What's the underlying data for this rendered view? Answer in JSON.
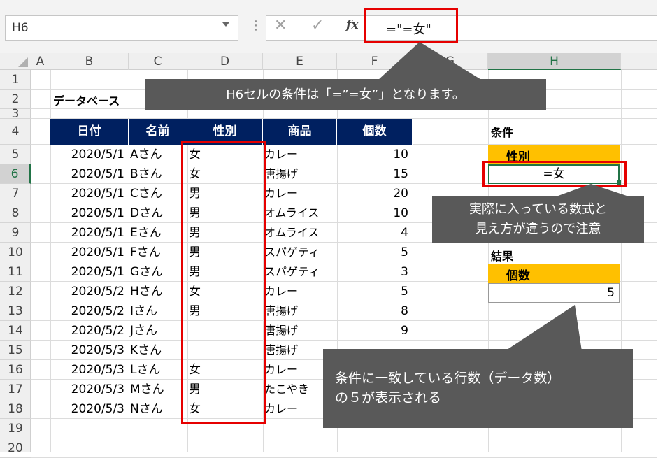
{
  "name_box": {
    "value": "H6"
  },
  "formula_bar": {
    "cancel_icon": "cross-icon",
    "enter_icon": "check-icon",
    "fx_label": "fx",
    "formula": "=\"=女\""
  },
  "columns": [
    "A",
    "B",
    "C",
    "D",
    "E",
    "F",
    "G",
    "H"
  ],
  "rows": [
    "1",
    "2",
    "3",
    "4",
    "5",
    "6",
    "7",
    "8",
    "9",
    "10",
    "11",
    "12",
    "13",
    "14",
    "15",
    "16",
    "17",
    "18",
    "19",
    "20"
  ],
  "database": {
    "title": "データベース",
    "headers": [
      "日付",
      "名前",
      "性別",
      "商品",
      "個数"
    ],
    "records": [
      [
        "2020/5/1",
        "Aさん",
        "女",
        "カレー",
        "10"
      ],
      [
        "2020/5/1",
        "Bさん",
        "女",
        "唐揚げ",
        "15"
      ],
      [
        "2020/5/1",
        "Cさん",
        "男",
        "カレー",
        "20"
      ],
      [
        "2020/5/1",
        "Dさん",
        "男",
        "オムライス",
        "10"
      ],
      [
        "2020/5/1",
        "Eさん",
        "男",
        "オムライス",
        "4"
      ],
      [
        "2020/5/1",
        "Fさん",
        "男",
        "スパゲティ",
        "5"
      ],
      [
        "2020/5/1",
        "Gさん",
        "男",
        "スパゲティ",
        "3"
      ],
      [
        "2020/5/2",
        "Hさん",
        "女",
        "カレー",
        "5"
      ],
      [
        "2020/5/2",
        "Iさん",
        "男",
        "唐揚げ",
        "8"
      ],
      [
        "2020/5/2",
        "Jさん",
        "",
        "唐揚げ",
        "9"
      ],
      [
        "2020/5/3",
        "Kさん",
        "",
        "唐揚げ",
        ""
      ],
      [
        "2020/5/3",
        "Lさん",
        "女",
        "カレー",
        ""
      ],
      [
        "2020/5/3",
        "Mさん",
        "男",
        "たこやき",
        ""
      ],
      [
        "2020/5/3",
        "Nさん",
        "女",
        "カレー",
        ""
      ]
    ]
  },
  "criteria": {
    "title": "条件",
    "header": "性別",
    "value": "=女"
  },
  "result": {
    "title": "結果",
    "header": "個数",
    "value": "5"
  },
  "callouts": {
    "formula_note": "H6セルの条件は「=”=女”」となります。",
    "display_note_line1": "実際に入っている数式と",
    "display_note_line2": "見え方が違うので注意",
    "result_note_line1": "条件に一致している行数（データ数）",
    "result_note_line2": "の５が表示される"
  },
  "colors": {
    "header_navy": "#002060",
    "criteria_gold": "#ffc000",
    "highlight_red": "#e60000",
    "callout_gray": "#595959",
    "excel_green": "#217346"
  }
}
